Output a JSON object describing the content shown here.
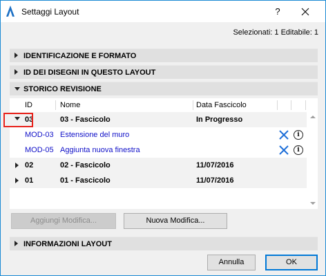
{
  "window": {
    "title": "Settaggi Layout",
    "help_label": "?"
  },
  "selection_info": "Selezionati: 1 Editabile: 1",
  "sections": {
    "identificazione": "IDENTIFICAZIONE E FORMATO",
    "id_disegni": "ID DEI DISEGNI IN QUESTO LAYOUT",
    "storico": "STORICO REVISIONE",
    "informazioni": "INFORMAZIONI LAYOUT"
  },
  "revision_table": {
    "columns": [
      "ID",
      "Nome",
      "Data Fascicolo"
    ],
    "rows": [
      {
        "id": "03",
        "name": "03 - Fascicolo",
        "date": "In Progresso"
      },
      {
        "id": "MOD-03",
        "name": "Estensione del muro"
      },
      {
        "id": "MOD-05",
        "name": "Aggiunta nuova finestra"
      },
      {
        "id": "02",
        "name": "02 - Fascicolo",
        "date": "11/07/2016"
      },
      {
        "id": "01",
        "name": "01 - Fascicolo",
        "date": "11/07/2016"
      }
    ]
  },
  "buttons": {
    "aggiungi": "Aggiungi Modifica...",
    "nuova": "Nuova Modifica...",
    "annulla": "Annulla",
    "ok": "OK"
  },
  "colors": {
    "link": "#1010c8",
    "highlight": "#e8221b",
    "x_icon": "#1e6fd9",
    "window_border": "#1a8ad4"
  },
  "icons": {
    "app": "archicad-icon",
    "close": "close-icon",
    "remove": "x-icon",
    "info": "info-icon"
  }
}
